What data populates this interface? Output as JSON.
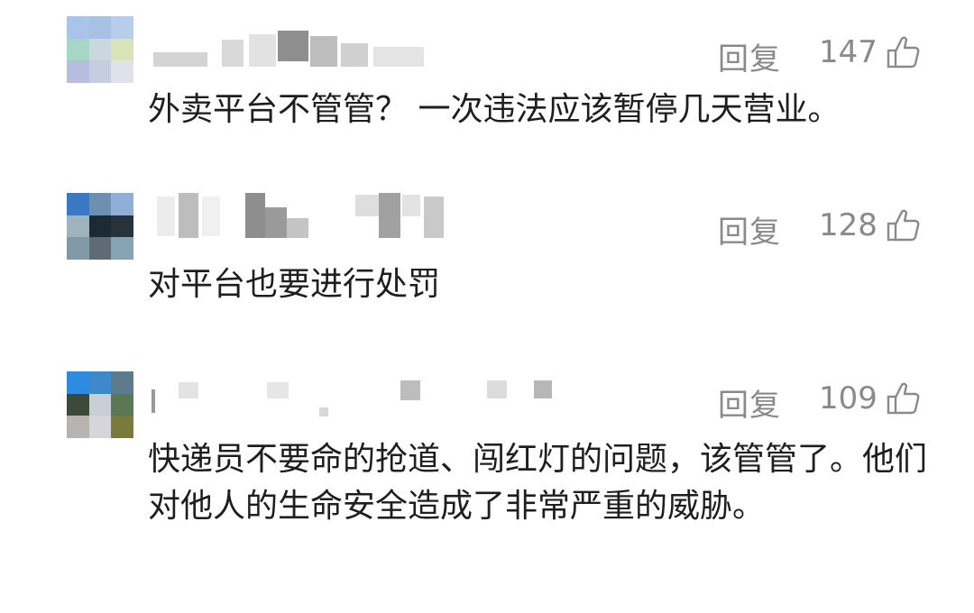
{
  "comments": [
    {
      "reply_label": "回复",
      "likes": "147",
      "text": "外卖平台不管管？ 一次违法应该暂停几天营业。",
      "avatar_colors": [
        "#a9c4e8",
        "#a7c1e3",
        "#b8cdea",
        "#a8d6c6",
        "#c9d8df",
        "#d8e3b8",
        "#b5bedf",
        "#c7cde0",
        "#dfe3e9"
      ]
    },
    {
      "reply_label": "回复",
      "likes": "128",
      "text": "对平台也要进行处罚",
      "avatar_colors": [
        "#3a78c4",
        "#6f8fb0",
        "#8fb0d6",
        "#9eb3bd",
        "#1c2a33",
        "#27323b",
        "#7f9aa6",
        "#5e6b74",
        "#85a3b3"
      ]
    },
    {
      "reply_label": "回复",
      "likes": "109",
      "text": "快递员不要命的抢道、闯红灯的问题，该管管了。他们对他人的生命安全造成了非常严重的威胁。",
      "avatar_colors": [
        "#2f8be0",
        "#3e89c9",
        "#5d7b8c",
        "#3d4a3a",
        "#c8cfd6",
        "#5a7856",
        "#b9b3b0",
        "#d6d6da",
        "#7a7a3a"
      ]
    }
  ],
  "icons": {
    "like": "thumbs-up-icon"
  }
}
